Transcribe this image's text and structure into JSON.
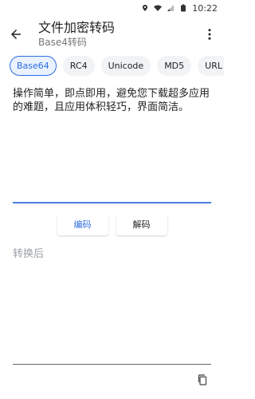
{
  "status": {
    "time": "10:22"
  },
  "app": {
    "title": "文件加密转码",
    "subtitle": "Base4转码"
  },
  "tabs": [
    {
      "label": "Base64",
      "active": true
    },
    {
      "label": "RC4",
      "active": false
    },
    {
      "label": "Unicode",
      "active": false
    },
    {
      "label": "MD5",
      "active": false
    },
    {
      "label": "URL",
      "active": false
    }
  ],
  "input": {
    "text": "操作简单，即点即用，避免您下载超多应用的难题，且应用体积轻巧，界面简洁。"
  },
  "actions": {
    "encode": "编码",
    "decode": "解码"
  },
  "result": {
    "label": "转换后"
  },
  "colors": {
    "accent": "#2d6cdf",
    "underline": "#4f7be3"
  },
  "icons": {
    "back": "arrow-left-icon",
    "more": "more-vert-icon",
    "copy": "copy-icon"
  }
}
